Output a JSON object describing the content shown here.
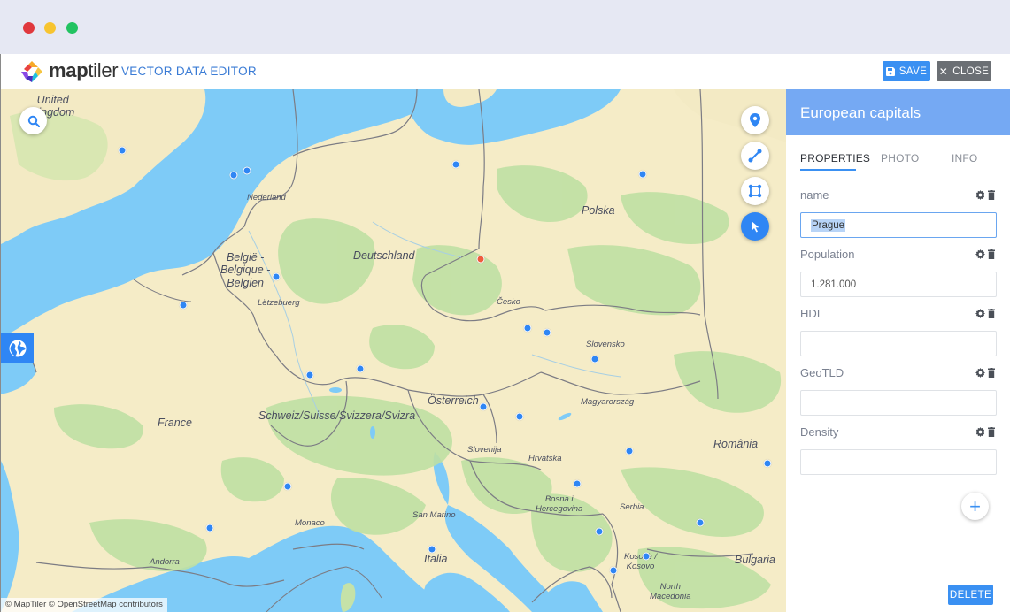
{
  "window": {
    "controls": [
      "close",
      "minimize",
      "maximize"
    ]
  },
  "header": {
    "brand_bold": "map",
    "brand_light": "tiler",
    "subtitle": "VECTOR DATA EDITOR",
    "save_label": "SAVE",
    "close_label": "CLOSE"
  },
  "colors": {
    "accent": "#3a90f2",
    "panel_header": "#75a9f3",
    "marker": "#2f86f4",
    "marker_selected": "#ef5b3d",
    "land": "#f5ecc7",
    "water": "#7ecbf7",
    "forest": "#bfe0a3"
  },
  "map": {
    "attribution": "© MapTiler © OpenStreetMap contributors",
    "tools": [
      {
        "name": "point-tool",
        "icon": "map-marker-icon",
        "active": false
      },
      {
        "name": "line-tool",
        "icon": "line-icon",
        "active": false
      },
      {
        "name": "polygon-tool",
        "icon": "polygon-icon",
        "active": false
      },
      {
        "name": "select-tool",
        "icon": "cursor-icon",
        "active": true
      }
    ],
    "labels": [
      {
        "text": "United Kingdom",
        "lines": [
          "United",
          "Kingdom"
        ]
      },
      {
        "text": "Nederland"
      },
      {
        "text": "België - Belgique - Belgien",
        "lines": [
          "België -",
          "Belgique -",
          "Belgien"
        ]
      },
      {
        "text": "Lëtzebuerg"
      },
      {
        "text": "Deutschland"
      },
      {
        "text": "Polska"
      },
      {
        "text": "Česko"
      },
      {
        "text": "Slovensko"
      },
      {
        "text": "Österreich"
      },
      {
        "text": "Magyarország"
      },
      {
        "text": "Schweiz/Suisse/Svizzera/Svizra"
      },
      {
        "text": "France"
      },
      {
        "text": "Slovenija"
      },
      {
        "text": "Hrvatska"
      },
      {
        "text": "România"
      },
      {
        "text": "Bosna i Hercegovina",
        "lines": [
          "Bosna i",
          "Hercegovina"
        ]
      },
      {
        "text": "Serbia"
      },
      {
        "text": "San Marino"
      },
      {
        "text": "Monaco"
      },
      {
        "text": "Italia"
      },
      {
        "text": "Andorra"
      },
      {
        "text": "Kosovë / Kosovo",
        "lines": [
          "Kosovë /",
          "Kosovo"
        ]
      },
      {
        "text": "Bulgaria"
      },
      {
        "text": "North Macedonia",
        "lines": [
          "North",
          "Macedonia"
        ]
      }
    ],
    "selected_feature": "Prague"
  },
  "panel": {
    "title": "European capitals",
    "tabs": [
      {
        "label": "PROPERTIES",
        "active": true
      },
      {
        "label": "PHOTO",
        "active": false
      },
      {
        "label": "INFO",
        "active": false
      }
    ],
    "fields": [
      {
        "label": "name",
        "value": "Prague",
        "focused": true
      },
      {
        "label": "Population",
        "value": "1.281.000",
        "focused": false
      },
      {
        "label": "HDI",
        "value": "",
        "focused": false
      },
      {
        "label": "GeoTLD",
        "value": "",
        "focused": false
      },
      {
        "label": "Density",
        "value": "",
        "focused": false
      }
    ],
    "add_label": "+",
    "delete_label": "DELETE"
  }
}
